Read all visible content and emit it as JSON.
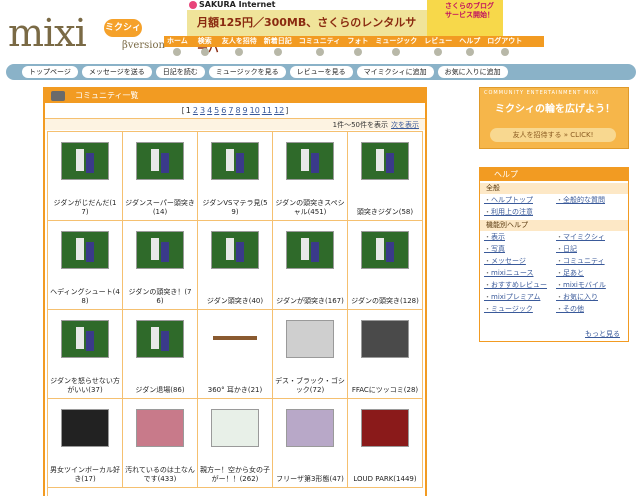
{
  "brand": {
    "logo": "mixi",
    "badge": "ミクシィ",
    "beta": "βversion"
  },
  "ad": {
    "top": "SAKURA Internet",
    "main": "月額125円／300MB、さくらのレンタルサーバ",
    "right": "さくらのブログ サービス開始！"
  },
  "topnav": [
    "ホーム",
    "検索",
    "友人を招待",
    "新着日記",
    "コミュニティ",
    "フォト",
    "ミュージック",
    "レビュー",
    "ヘルプ",
    "ログアウト"
  ],
  "subnav": [
    "トップページ",
    "メッセージを送る",
    "日記を読む",
    "ミュージックを見る",
    "レビューを見る",
    "マイミクシィに追加",
    "お気に入りに追加"
  ],
  "panel": {
    "title": "コミュニティ一覧",
    "pager_prefix": "[",
    "pager_current": "1",
    "pages": [
      "2",
      "3",
      "4",
      "5",
      "6",
      "7",
      "8",
      "9",
      "10",
      "11",
      "12"
    ],
    "pager_suffix": "]",
    "range": "1件〜50件を表示",
    "next": "次を表示"
  },
  "communities": [
    {
      "name": "ジダンがじだんだ(17)",
      "thumb": "zidane"
    },
    {
      "name": "ジダンスーパー頭突き(14)",
      "thumb": "zidane"
    },
    {
      "name": "ジダンVSマテラ見(59)",
      "thumb": "zidane"
    },
    {
      "name": "ジダンの頭突きスペシャル(451)",
      "thumb": "zidane"
    },
    {
      "name": "頭突きジダン(58)",
      "thumb": "zidane"
    },
    {
      "name": "ヘディングシュート(48)",
      "thumb": "zidane"
    },
    {
      "name": "ジダンの頭突き！(76)",
      "thumb": "zidane"
    },
    {
      "name": "ジダン頭突き(40)",
      "thumb": "zidane"
    },
    {
      "name": "ジダンが頭突き(167)",
      "thumb": "zidane"
    },
    {
      "name": "ジダンの頭突き(128)",
      "thumb": "zidane"
    },
    {
      "name": "ジダンを怒らせない方がいい(37)",
      "thumb": "zidane"
    },
    {
      "name": "ジダン退場(86)",
      "thumb": "zidane"
    },
    {
      "name": "360° 耳かき(21)",
      "thumb": "bar"
    },
    {
      "name": "デス・ブラック・ゴシック(72)",
      "thumb": "gray"
    },
    {
      "name": "FFACにツッコミ(28)",
      "thumb": "dark"
    },
    {
      "name": "男女ツインボーカル好き(17)",
      "thumb": "fig"
    },
    {
      "name": "汚れているのは土なんです(433)",
      "thumb": "anime"
    },
    {
      "name": "親方ー！空から女の子がー！！(262)",
      "thumb": "robot"
    },
    {
      "name": "フリーザ第3形態(47)",
      "thumb": "frieza"
    },
    {
      "name": "LOUD PARK(1449)",
      "thumb": "loud"
    }
  ],
  "side": {
    "banner_tag": "COMMUNITY ENTERTAINMENT MIXI",
    "banner_title": "ミクシィの輪を広げよう！",
    "banner_button": "友人を招待する » CLICK!",
    "help_title": "ヘルプ",
    "general": "全般",
    "general_links": [
      [
        "ヘルプトップ",
        "全般的な質問"
      ],
      [
        "利用上の注意",
        ""
      ]
    ],
    "feature": "機能別ヘルプ",
    "feature_links": [
      [
        "表示",
        "マイミクシィ"
      ],
      [
        "写真",
        "日記"
      ],
      [
        "メッセージ",
        "コミュニティ"
      ],
      [
        "mixiニュース",
        "足あと"
      ],
      [
        "おすすめレビュー",
        "mixiモバイル"
      ],
      [
        "mixiプレミアム",
        "お気に入り"
      ],
      [
        "ミュージック",
        "その他"
      ]
    ],
    "more": "もっと見る"
  }
}
